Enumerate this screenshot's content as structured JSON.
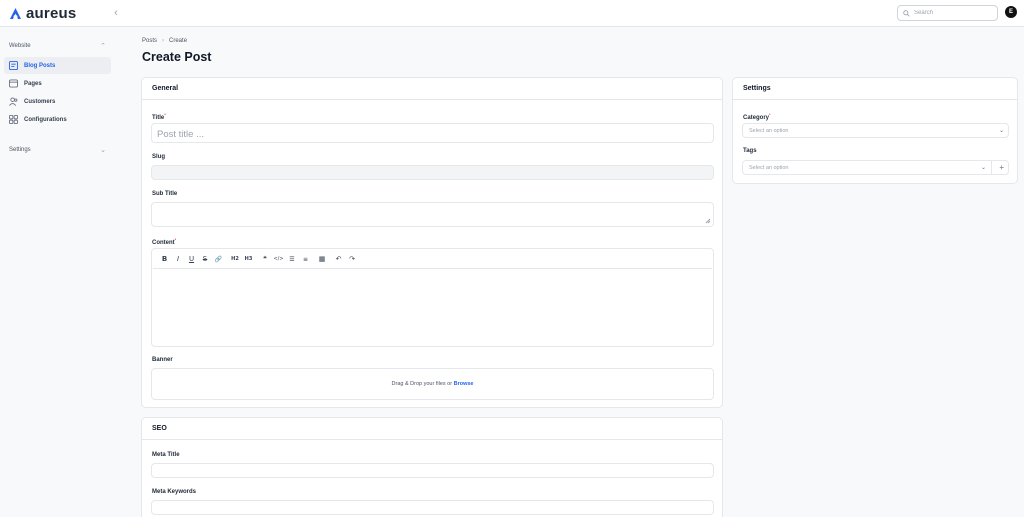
{
  "app": {
    "name": "aureus"
  },
  "header": {
    "search_placeholder": "Search",
    "avatar_initial": "E"
  },
  "sidebar": {
    "group1": "Website",
    "items": [
      {
        "label": "Blog Posts",
        "icon": "blog-icon",
        "active": true
      },
      {
        "label": "Pages",
        "icon": "pages-icon"
      },
      {
        "label": "Customers",
        "icon": "users-icon"
      },
      {
        "label": "Configurations",
        "icon": "config-icon"
      }
    ],
    "group2": "Settings"
  },
  "breadcrumb": {
    "parent": "Posts",
    "sep": "›",
    "current": "Create"
  },
  "page_title": "Create Post",
  "general": {
    "heading": "General",
    "title_label": "Title",
    "title_placeholder": "Post title ...",
    "slug_label": "Slug",
    "subtitle_label": "Sub Title",
    "content_label": "Content",
    "banner_label": "Banner",
    "drop_text": "Drag & Drop your files or ",
    "browse_text": "Browse"
  },
  "toolbar": {
    "bold": "B",
    "italic": "I",
    "underline": "U",
    "strike": "S",
    "link": "🔗",
    "h2": "H2",
    "h3": "H3",
    "quote": "❝",
    "code": "</>",
    "bullets": "☰",
    "numbers": "≡",
    "table": "▦",
    "undo": "↶",
    "redo": "↷"
  },
  "seo": {
    "heading": "SEO",
    "meta_title_label": "Meta Title",
    "meta_keywords_label": "Meta Keywords"
  },
  "settings": {
    "heading": "Settings",
    "category_label": "Category",
    "category_placeholder": "Select an option",
    "tags_label": "Tags",
    "tags_placeholder": "Select an option",
    "add": "+"
  },
  "colors": {
    "accent": "#2563eb",
    "required": "#dc2626"
  }
}
